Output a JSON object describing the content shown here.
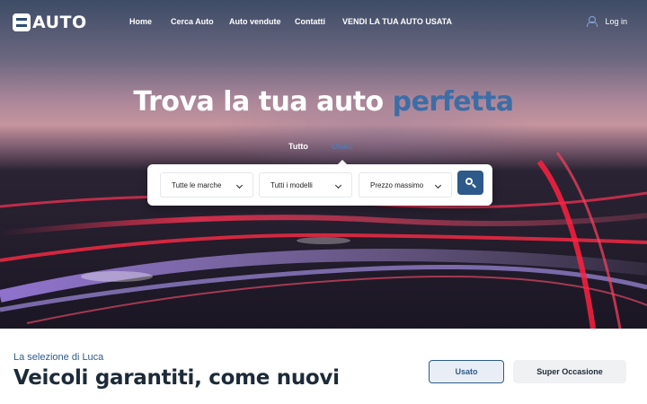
{
  "brand": {
    "logo_text": "AUTO"
  },
  "nav": {
    "items": [
      {
        "label": "Home"
      },
      {
        "label": "Cerca Auto"
      },
      {
        "label": "Auto vendute"
      },
      {
        "label": "Contatti"
      },
      {
        "label": "VENDI LA TUA AUTO USATA"
      }
    ],
    "login_label": "Log in"
  },
  "hero": {
    "headline_main": "Trova la tua auto ",
    "headline_accent": "perfetta",
    "tabs": [
      {
        "label": "Tutto",
        "active": true
      },
      {
        "label": "Usato",
        "active": false
      }
    ],
    "search": {
      "brand_select": "Tutte le marche",
      "model_select": "Tutti i modelli",
      "price_select": "Prezzo massimo",
      "search_icon": "search-icon"
    }
  },
  "section": {
    "subtitle": "La selezione di Luca",
    "title": "Veicoli garantiti, come nuovi",
    "filters": [
      {
        "label": "Usato",
        "active": true
      },
      {
        "label": "Super Occasione",
        "active": false
      }
    ]
  },
  "colors": {
    "accent": "#2d5a8a",
    "headline_accent": "#3d6da6",
    "title_text": "#1d2a38"
  }
}
